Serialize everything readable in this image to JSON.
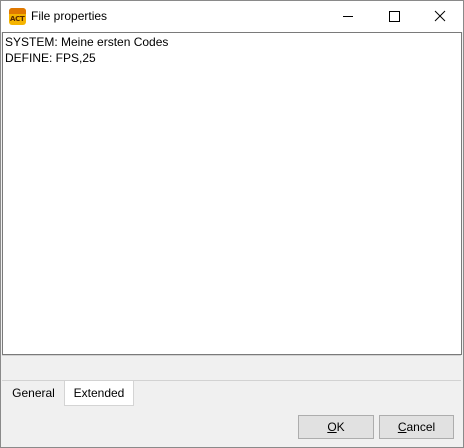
{
  "window": {
    "title": "File properties",
    "icon_name": "app-logo-icon",
    "icon_text": "ACT",
    "controls": {
      "minimize_icon": "minimize-icon",
      "maximize_icon": "maximize-icon",
      "close_icon": "close-icon"
    }
  },
  "editor": {
    "lines": [
      "SYSTEM: Meine ersten Codes",
      "DEFINE: FPS,25"
    ]
  },
  "tabs": [
    {
      "label": "General",
      "active": false
    },
    {
      "label": "Extended",
      "active": true
    }
  ],
  "buttons": {
    "ok": {
      "mnemonic": "O",
      "rest": "K"
    },
    "cancel": {
      "mnemonic": "C",
      "rest": "ancel"
    }
  },
  "colors": {
    "window_bg": "#f0f0f0",
    "titlebar_bg": "#ffffff",
    "icon_orange": "#f5b400",
    "button_bg": "#e1e1e1"
  }
}
